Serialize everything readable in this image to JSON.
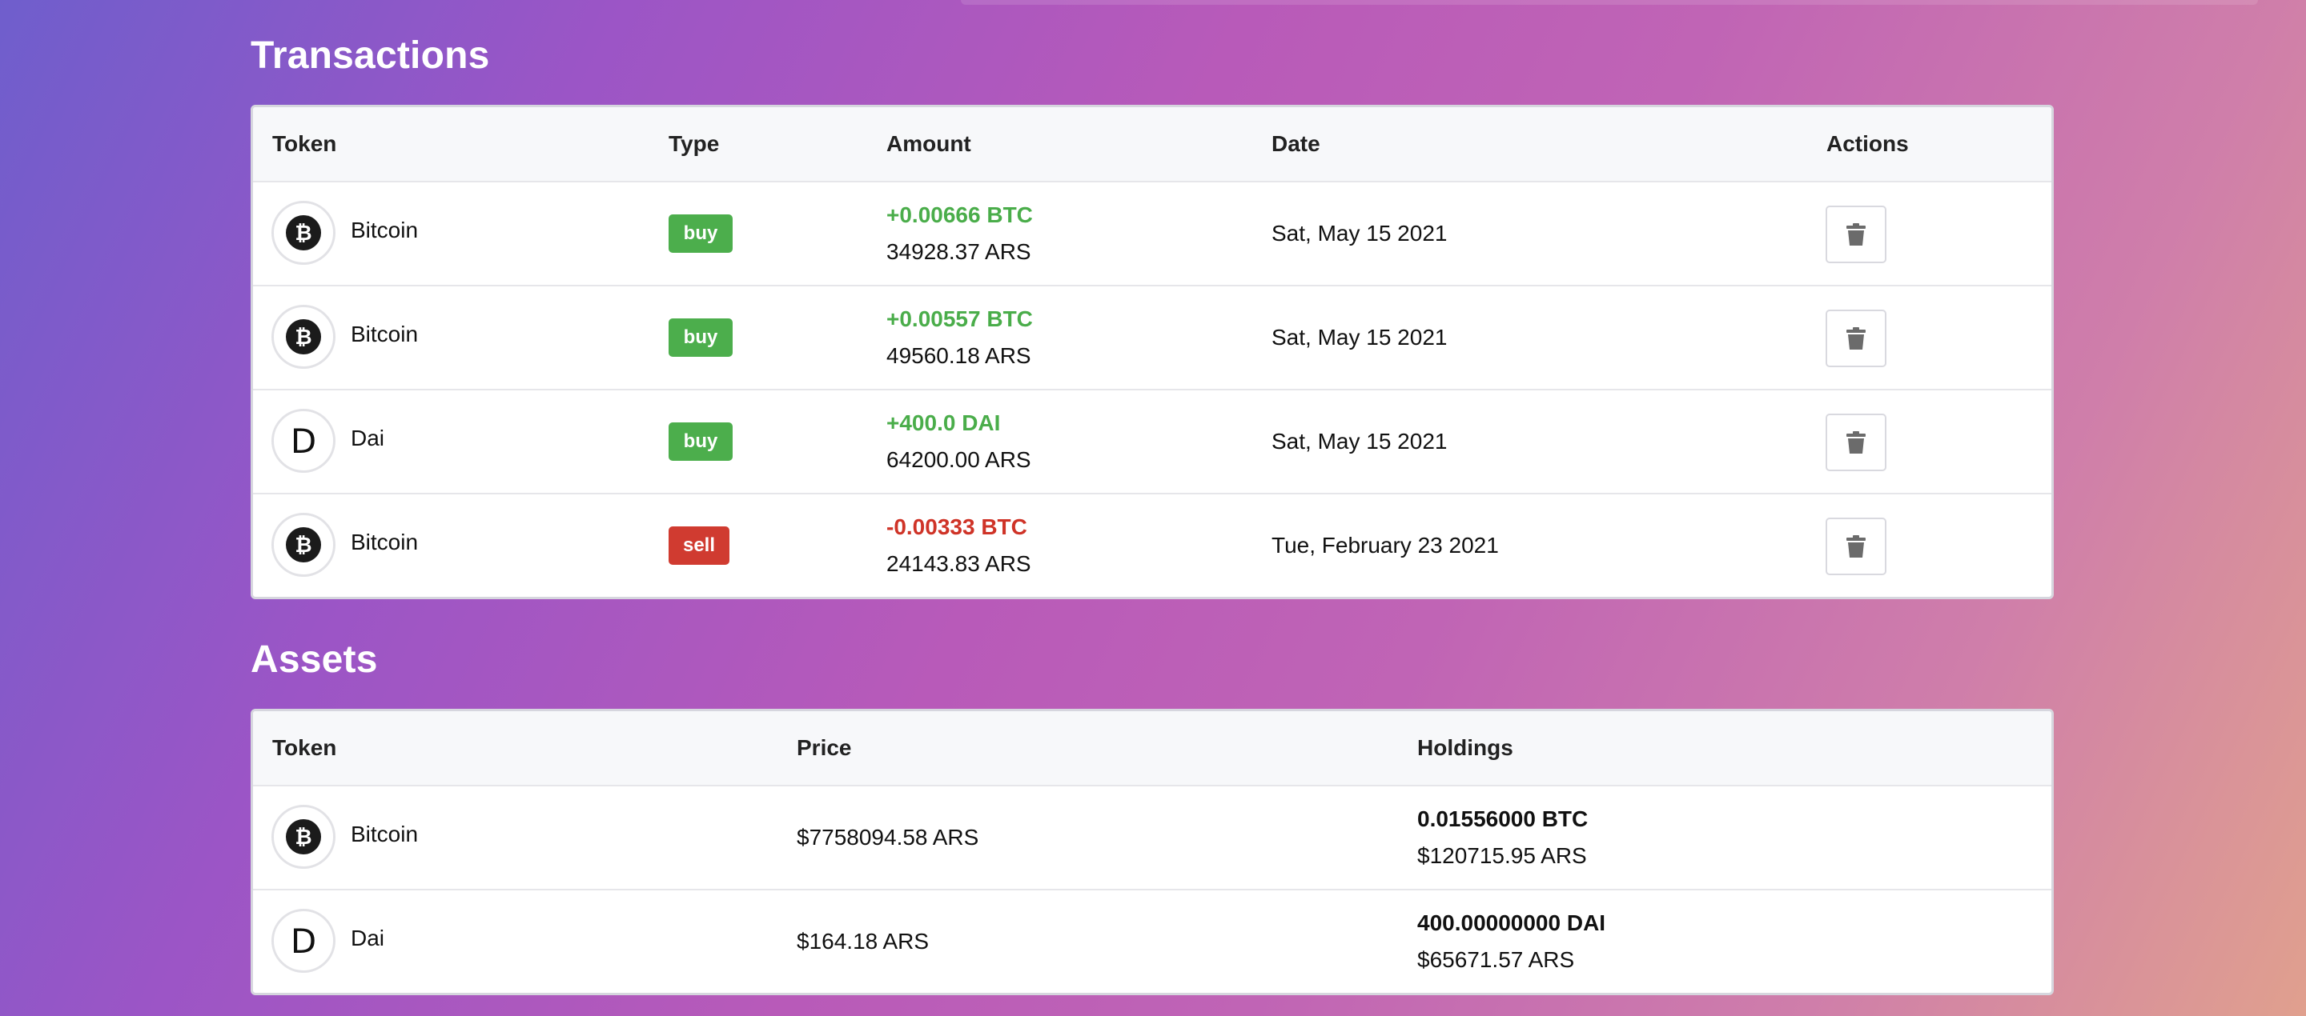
{
  "transactions": {
    "title": "Transactions",
    "headers": {
      "token": "Token",
      "type": "Type",
      "amount": "Amount",
      "date": "Date",
      "actions": "Actions"
    },
    "rows": [
      {
        "token": "Bitcoin",
        "icon": "bitcoin-icon",
        "type": "buy",
        "amount": "+0.00666 BTC",
        "fiat": "34928.37 ARS",
        "date": "Sat, May 15 2021"
      },
      {
        "token": "Bitcoin",
        "icon": "bitcoin-icon",
        "type": "buy",
        "amount": "+0.00557 BTC",
        "fiat": "49560.18 ARS",
        "date": "Sat, May 15 2021"
      },
      {
        "token": "Dai",
        "icon": "dai-icon",
        "type": "buy",
        "amount": "+400.0 DAI",
        "fiat": "64200.00 ARS",
        "date": "Sat, May 15 2021"
      },
      {
        "token": "Bitcoin",
        "icon": "bitcoin-icon",
        "type": "sell",
        "amount": "-0.00333 BTC",
        "fiat": "24143.83 ARS",
        "date": "Tue, February 23 2021"
      }
    ]
  },
  "assets": {
    "title": "Assets",
    "headers": {
      "token": "Token",
      "price": "Price",
      "holdings": "Holdings"
    },
    "rows": [
      {
        "token": "Bitcoin",
        "icon": "bitcoin-icon",
        "price": "$7758094.58 ARS",
        "holdings": "0.01556000 BTC",
        "holdings_fiat": "$120715.95 ARS"
      },
      {
        "token": "Dai",
        "icon": "dai-icon",
        "price": "$164.18 ARS",
        "holdings": "400.00000000 DAI",
        "holdings_fiat": "$65671.57 ARS"
      }
    ]
  },
  "icons": {
    "bitcoin_glyph": "₿",
    "dai_glyph": "D",
    "delete": "trash-icon"
  },
  "colors": {
    "buy": "#4cae4c",
    "sell": "#d03b30",
    "positive": "#4aad4a",
    "negative": "#cf3327"
  }
}
